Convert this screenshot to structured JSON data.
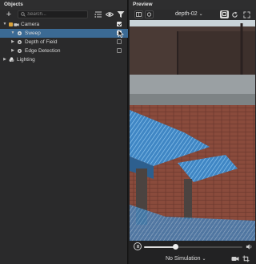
{
  "objects_panel": {
    "title": "Objects",
    "search_placeholder": "Search...",
    "tree": [
      {
        "label": "Camera",
        "checked": true,
        "selected": false
      },
      {
        "label": "Sweep",
        "checked": true,
        "selected": true
      },
      {
        "label": "Depth of Field",
        "checked": false,
        "selected": false
      },
      {
        "label": "Edge Detection",
        "checked": false,
        "selected": false
      },
      {
        "label": "Lighting",
        "checked": null,
        "selected": false
      }
    ]
  },
  "preview_panel": {
    "title": "Preview",
    "camera_name": "depth-02",
    "simulation_label": "No Simulation",
    "playback_progress": 0.32
  },
  "colors": {
    "selection": "#3b6a94",
    "panel_bg": "#2a2a2b",
    "depth_overlay": "#4a9bd6"
  }
}
